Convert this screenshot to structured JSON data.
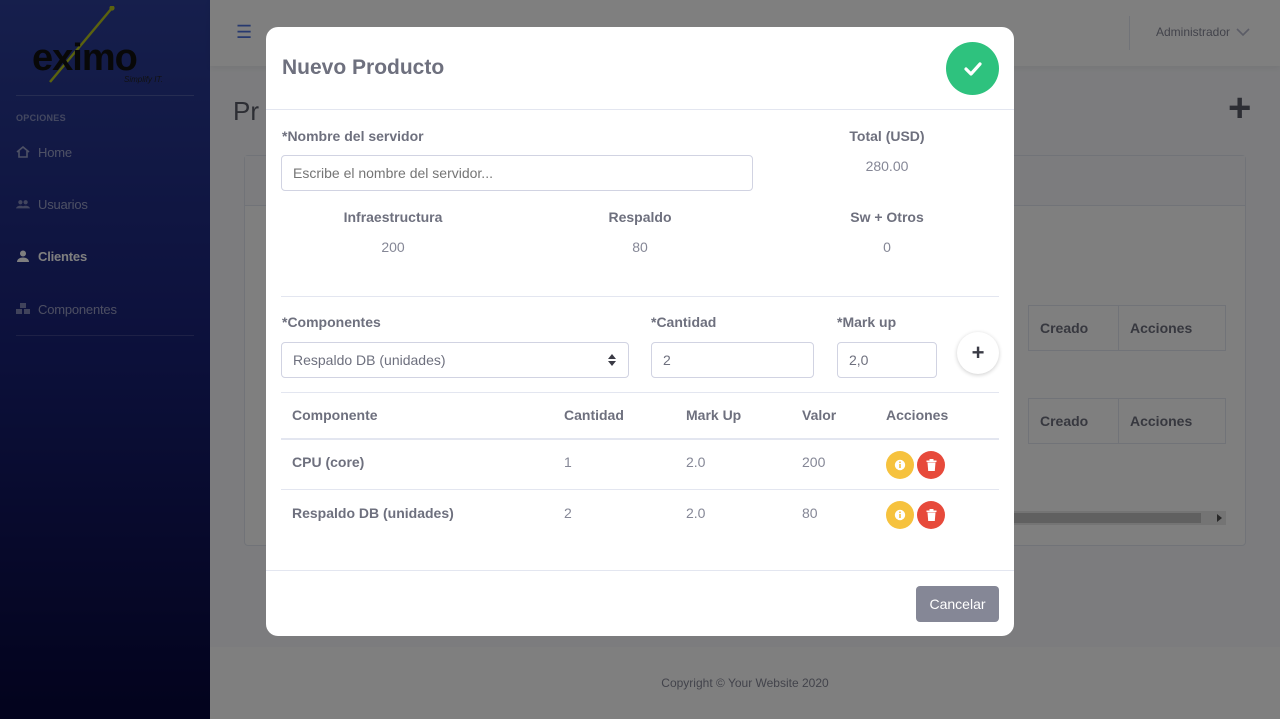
{
  "brand": {
    "logo_text": "eximo",
    "tagline": "Simplify IT."
  },
  "sidebar": {
    "heading": "OPCIONES",
    "items": [
      {
        "label": "Home",
        "icon": "home-icon"
      },
      {
        "label": "Usuarios",
        "icon": "users-icon"
      },
      {
        "label": "Clientes",
        "icon": "user-icon",
        "active": true
      },
      {
        "label": "Componentes",
        "icon": "cubes-icon"
      }
    ]
  },
  "topbar": {
    "user": "Administrador"
  },
  "page": {
    "title": "Pr",
    "table_headers": {
      "created": "Creado",
      "actions": "Acciones"
    }
  },
  "footer": {
    "copyright": "Copyright © Your Website 2020"
  },
  "modal": {
    "title": "Nuevo Producto",
    "server_name_label": "*Nombre del servidor",
    "server_name_placeholder": "Escribe el nombre del servidor...",
    "total_label": "Total (USD)",
    "total_value": "280.00",
    "summary": [
      {
        "label": "Infraestructura",
        "value": "200"
      },
      {
        "label": "Respaldo",
        "value": "80"
      },
      {
        "label": "Sw + Otros",
        "value": "0"
      }
    ],
    "component_label": "*Componentes",
    "component_selected": "Respaldo DB (unidades)",
    "quantity_label": "*Cantidad",
    "quantity_value": "2",
    "markup_label": "*Mark up",
    "markup_value": "2,0",
    "table": {
      "headers": [
        "Componente",
        "Cantidad",
        "Mark Up",
        "Valor",
        "Acciones"
      ],
      "rows": [
        {
          "component": "CPU (core)",
          "quantity": "1",
          "markup": "2.0",
          "value": "200"
        },
        {
          "component": "Respaldo DB (unidades)",
          "quantity": "2",
          "markup": "2.0",
          "value": "80"
        }
      ]
    },
    "cancel_label": "Cancelar"
  },
  "colors": {
    "primary": "#4e73df",
    "success": "#2ec27e",
    "warning": "#f6c23e",
    "danger": "#e74a3b",
    "secondary": "#858796"
  }
}
